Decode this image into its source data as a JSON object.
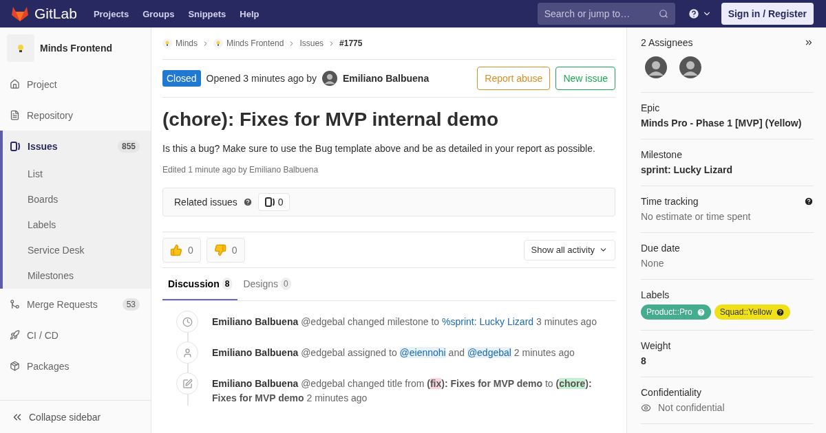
{
  "navbar": {
    "brand": "GitLab",
    "links": [
      "Projects",
      "Groups",
      "Snippets",
      "Help"
    ],
    "search": {
      "placeholder": "Search or jump to…"
    },
    "signin": "Sign in / Register"
  },
  "sidebar": {
    "project": "Minds Frontend",
    "items": [
      {
        "kind": "project",
        "label": "Project",
        "selected": false
      },
      {
        "kind": "repository",
        "label": "Repository",
        "selected": false
      },
      {
        "kind": "issues",
        "label": "Issues",
        "count": "855",
        "selected": true,
        "children": [
          {
            "label": "List",
            "selected": false
          },
          {
            "label": "Boards",
            "selected": false
          },
          {
            "label": "Labels",
            "selected": false
          },
          {
            "label": "Service Desk",
            "selected": false
          },
          {
            "label": "Milestones",
            "selected": false
          }
        ]
      },
      {
        "kind": "merge",
        "label": "Merge Requests",
        "count": "53",
        "selected": false
      },
      {
        "kind": "cicd",
        "label": "CI / CD",
        "selected": false
      },
      {
        "kind": "packages",
        "label": "Packages",
        "selected": false
      }
    ],
    "collapse": "Collapse sidebar"
  },
  "breadcrumbs": [
    {
      "label": "Minds",
      "icon": true
    },
    {
      "label": "Minds Frontend",
      "icon": true
    },
    {
      "label": "Issues",
      "icon": false
    },
    {
      "label": "#1775",
      "icon": false
    }
  ],
  "issue": {
    "status": "Closed",
    "opened": "Opened 3 minutes ago by",
    "author": "Emiliano Balbuena",
    "report": "Report abuse",
    "new_issue": "New issue",
    "title": "(chore): Fixes for MVP internal demo",
    "description": "Is this a bug? Make sure to use the Bug template above and be as detailed in your report as possible.",
    "edited": "Edited 1 minute ago by Emiliano Balbuena",
    "related": {
      "label": "Related issues",
      "count": "0"
    },
    "reactions": [
      {
        "kind": "up",
        "count": "0"
      },
      {
        "kind": "down",
        "count": "0"
      }
    ],
    "activity_filter": "Show all activity",
    "tabs": [
      {
        "label": "Discussion",
        "count": "8",
        "selected": true
      },
      {
        "label": "Designs",
        "count": "0",
        "selected": false
      }
    ],
    "notes": [
      {
        "kind": "milestone",
        "parts": [
          {
            "kind": "author",
            "text": "Emiliano Balbuena"
          },
          {
            "kind": "text",
            "text": " @edgebal changed milestone to "
          },
          {
            "kind": "link",
            "text": "%sprint: Lucky Lizard"
          },
          {
            "kind": "text",
            "text": " 3 minutes ago"
          }
        ]
      },
      {
        "kind": "assignee",
        "parts": [
          {
            "kind": "author",
            "text": "Emiliano Balbuena"
          },
          {
            "kind": "text",
            "text": " @edgebal assigned to "
          },
          {
            "kind": "mention",
            "text": "@eiennohi"
          },
          {
            "kind": "text",
            "text": " and "
          },
          {
            "kind": "mention",
            "text": "@edgebal"
          },
          {
            "kind": "text",
            "text": " 2 minutes ago"
          }
        ]
      },
      {
        "kind": "title",
        "parts": [
          {
            "kind": "author",
            "text": "Emiliano Balbuena"
          },
          {
            "kind": "text",
            "text": " @edgebal changed title from "
          },
          {
            "kind": "strong",
            "text": "("
          },
          {
            "kind": "removed",
            "text": "fix"
          },
          {
            "kind": "strong",
            "text": "): Fixes for MVP demo"
          },
          {
            "kind": "text",
            "text": " to "
          },
          {
            "kind": "strong",
            "text": "("
          },
          {
            "kind": "added",
            "text": "chore"
          },
          {
            "kind": "strong",
            "text": "): Fixes for MVP demo"
          },
          {
            "kind": "text",
            "text": " 2 minutes ago"
          }
        ]
      }
    ]
  },
  "right_sidebar": {
    "assignees": "2 Assignees",
    "blocks": [
      {
        "kind": "bold",
        "title": "Epic",
        "value": "Minds Pro - Phase 1 [MVP] (Yellow)"
      },
      {
        "kind": "bold",
        "title": "Milestone",
        "value": "sprint: Lucky Lizard"
      },
      {
        "kind": "muted",
        "title": "Time tracking",
        "value": "No estimate or time spent",
        "help": true
      },
      {
        "kind": "muted",
        "title": "Due date",
        "value": "None"
      },
      {
        "kind": "labels",
        "title": "Labels",
        "labels": [
          {
            "text": "Product::Pro",
            "color": "#44ad8e"
          },
          {
            "text": "Squad::Yellow",
            "color": "#f0e01a"
          }
        ]
      },
      {
        "kind": "bold",
        "title": "Weight",
        "value": "8"
      },
      {
        "kind": "eye",
        "title": "Confidentiality",
        "value": "Not confidential"
      }
    ]
  }
}
